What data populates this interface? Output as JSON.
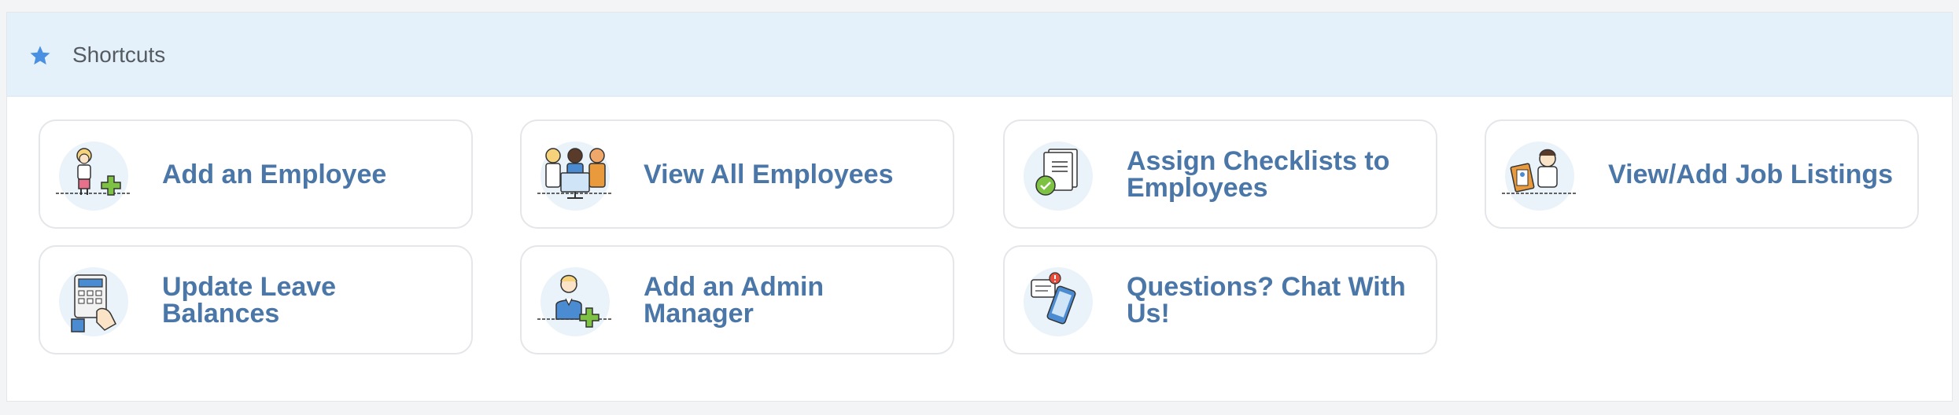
{
  "panel": {
    "title": "Shortcuts",
    "title_icon": "star-icon"
  },
  "shortcuts": [
    {
      "label": "Add an Employee",
      "icon": "add-employee-icon"
    },
    {
      "label": "View All Employees",
      "icon": "employees-group-icon"
    },
    {
      "label": "Assign Checklists to Employees",
      "icon": "checklist-icon"
    },
    {
      "label": "View/Add Job Listings",
      "icon": "job-listings-icon"
    },
    {
      "label": "Update Leave Balances",
      "icon": "calculator-icon"
    },
    {
      "label": "Add an Admin Manager",
      "icon": "add-admin-icon"
    },
    {
      "label": "Questions? Chat With Us!",
      "icon": "chat-phone-icon"
    }
  ],
  "colors": {
    "accent": "#4a90e2",
    "link": "#4a76a8",
    "header_bg": "#e4f1fb",
    "plus_green": "#7dc242"
  }
}
